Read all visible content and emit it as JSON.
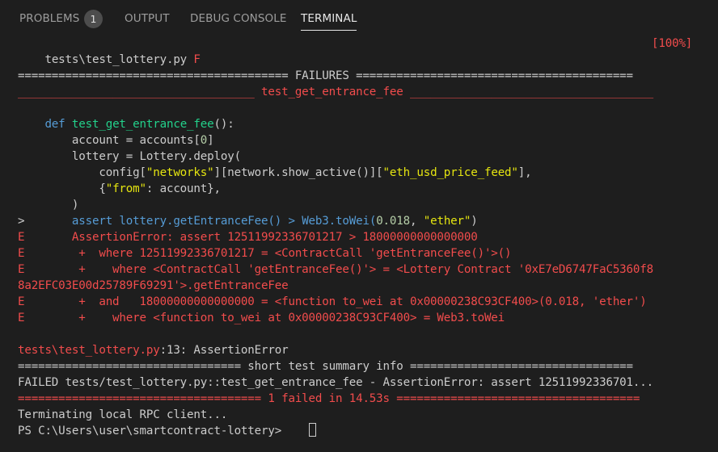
{
  "tabs": [
    {
      "label": "PROBLEMS",
      "badge": "1",
      "active": false
    },
    {
      "label": "OUTPUT",
      "active": false
    },
    {
      "label": "DEBUG CONSOLE",
      "active": false
    },
    {
      "label": "TERMINAL",
      "active": true
    }
  ],
  "terminal": {
    "line1_path": "tests\\test_lottery.py ",
    "line1_result": "F",
    "line1_percent": "[100%]",
    "failures_header": "======================================== FAILURES =========================================",
    "test_header": "___________________________________ test_get_entrance_fee ____________________________________",
    "code": {
      "def_kw": "    def ",
      "def_name": "test_get_entrance_fee",
      "def_rest": "():",
      "l_account_a": "        account = accounts[",
      "l_account_num": "0",
      "l_account_b": "]",
      "l_lottery": "        lottery = Lottery.deploy(",
      "l_config_a": "            config[",
      "l_config_s1": "\"networks\"",
      "l_config_b": "][network.show_active()][",
      "l_config_s2": "\"eth_usd_price_feed\"",
      "l_config_c": "],",
      "l_from_a": "            {",
      "l_from_s": "\"from\"",
      "l_from_b": ": account},",
      "l_close": "        )",
      "l_assert_a": ">       ",
      "l_assert_b": "assert lottery.getEntranceFee() > Web3.toWei(",
      "l_assert_num": "0.018",
      "l_assert_c": ", ",
      "l_assert_s": "\"ether\"",
      "l_assert_d": ")"
    },
    "errors": [
      "E       AssertionError: assert 12511992336701217 > 18000000000000000",
      "E        +  where 12511992336701217 = <ContractCall 'getEntranceFee()'>()",
      "E        +    where <ContractCall 'getEntranceFee()'> = <Lottery Contract '0xE7eD6747FaC5360f8",
      "8a2EFC03E00d25789F69291'>.getEntranceFee",
      "E        +  and   18000000000000000 = <function to_wei at 0x00000238C93CF400>(0.018, 'ether')",
      "E        +    where <function to_wei at 0x00000238C93CF400> = Web3.toWei"
    ],
    "location_path": "tests\\test_lottery.py",
    "location_rest": ":13: AssertionError",
    "summary_header": "================================= short test summary info =================================",
    "failed_line": "FAILED tests/test_lottery.py::test_get_entrance_fee - AssertionError: assert 12511992336701...",
    "result_line": "==================================== 1 failed in 14.53s ====================================",
    "terminating": "Terminating local RPC client...",
    "prompt": "PS C:\\Users\\user\\smartcontract-lottery> "
  }
}
